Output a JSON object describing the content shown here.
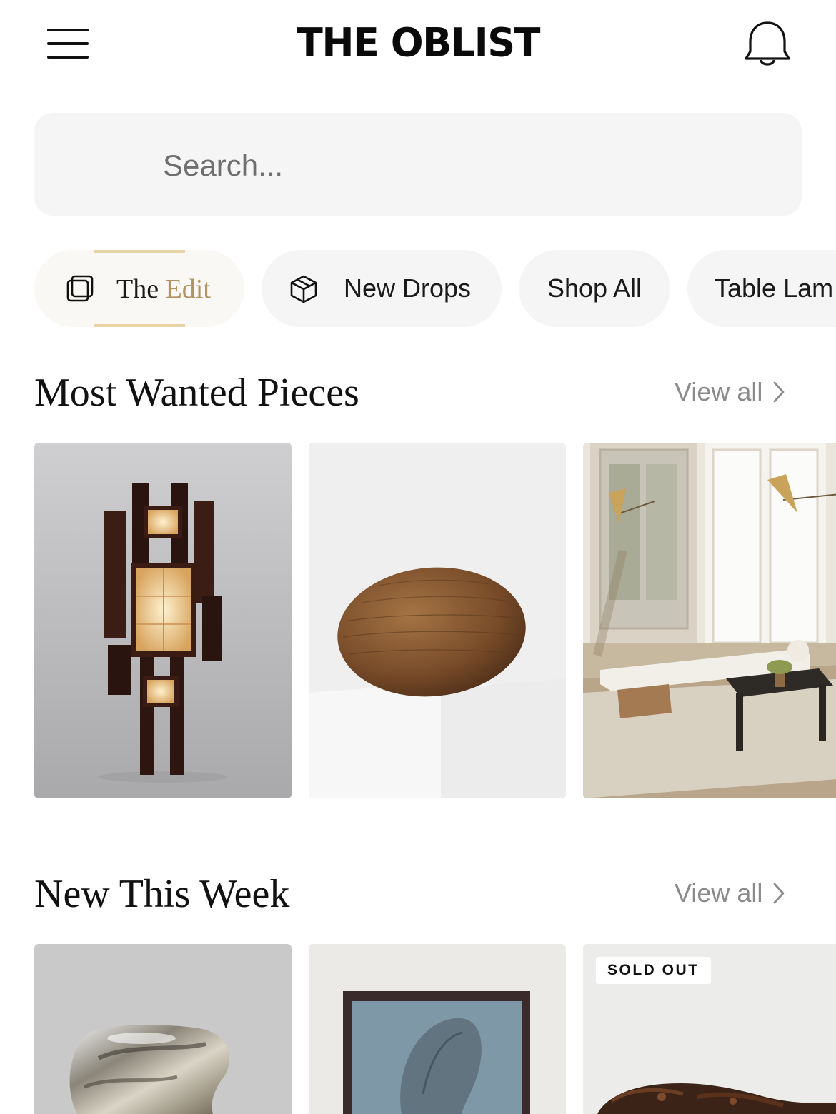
{
  "header": {
    "logo_text": "THE OBLIST",
    "menu_icon": "hamburger-menu-icon",
    "notification_icon": "bell-icon"
  },
  "search": {
    "placeholder": "Search...",
    "icon": "search-icon"
  },
  "chips": [
    {
      "label_part1": "The ",
      "label_part2": "Edit",
      "icon": "stacked-squares-icon",
      "selected": true
    },
    {
      "label": "New Drops",
      "icon": "box-icon"
    },
    {
      "label": "Shop All"
    },
    {
      "label": "Table Lam"
    }
  ],
  "sections": [
    {
      "title": "Most Wanted Pieces",
      "view_all_label": "View all",
      "items": [
        {
          "depicts": "lamp"
        },
        {
          "depicts": "wooden-egg-sculpture"
        },
        {
          "depicts": "living-room-daybed"
        }
      ]
    },
    {
      "title": "New This Week",
      "view_all_label": "View all",
      "items": [
        {
          "depicts": "chrome-sculpture"
        },
        {
          "depicts": "framed-painting"
        },
        {
          "depicts": "driftwood-piece",
          "badge": "SOLD OUT"
        }
      ]
    }
  ],
  "colors": {
    "accent_gold": "#b29262",
    "chip_bg": "#f5f5f5",
    "text_muted": "#8a8a8a"
  }
}
